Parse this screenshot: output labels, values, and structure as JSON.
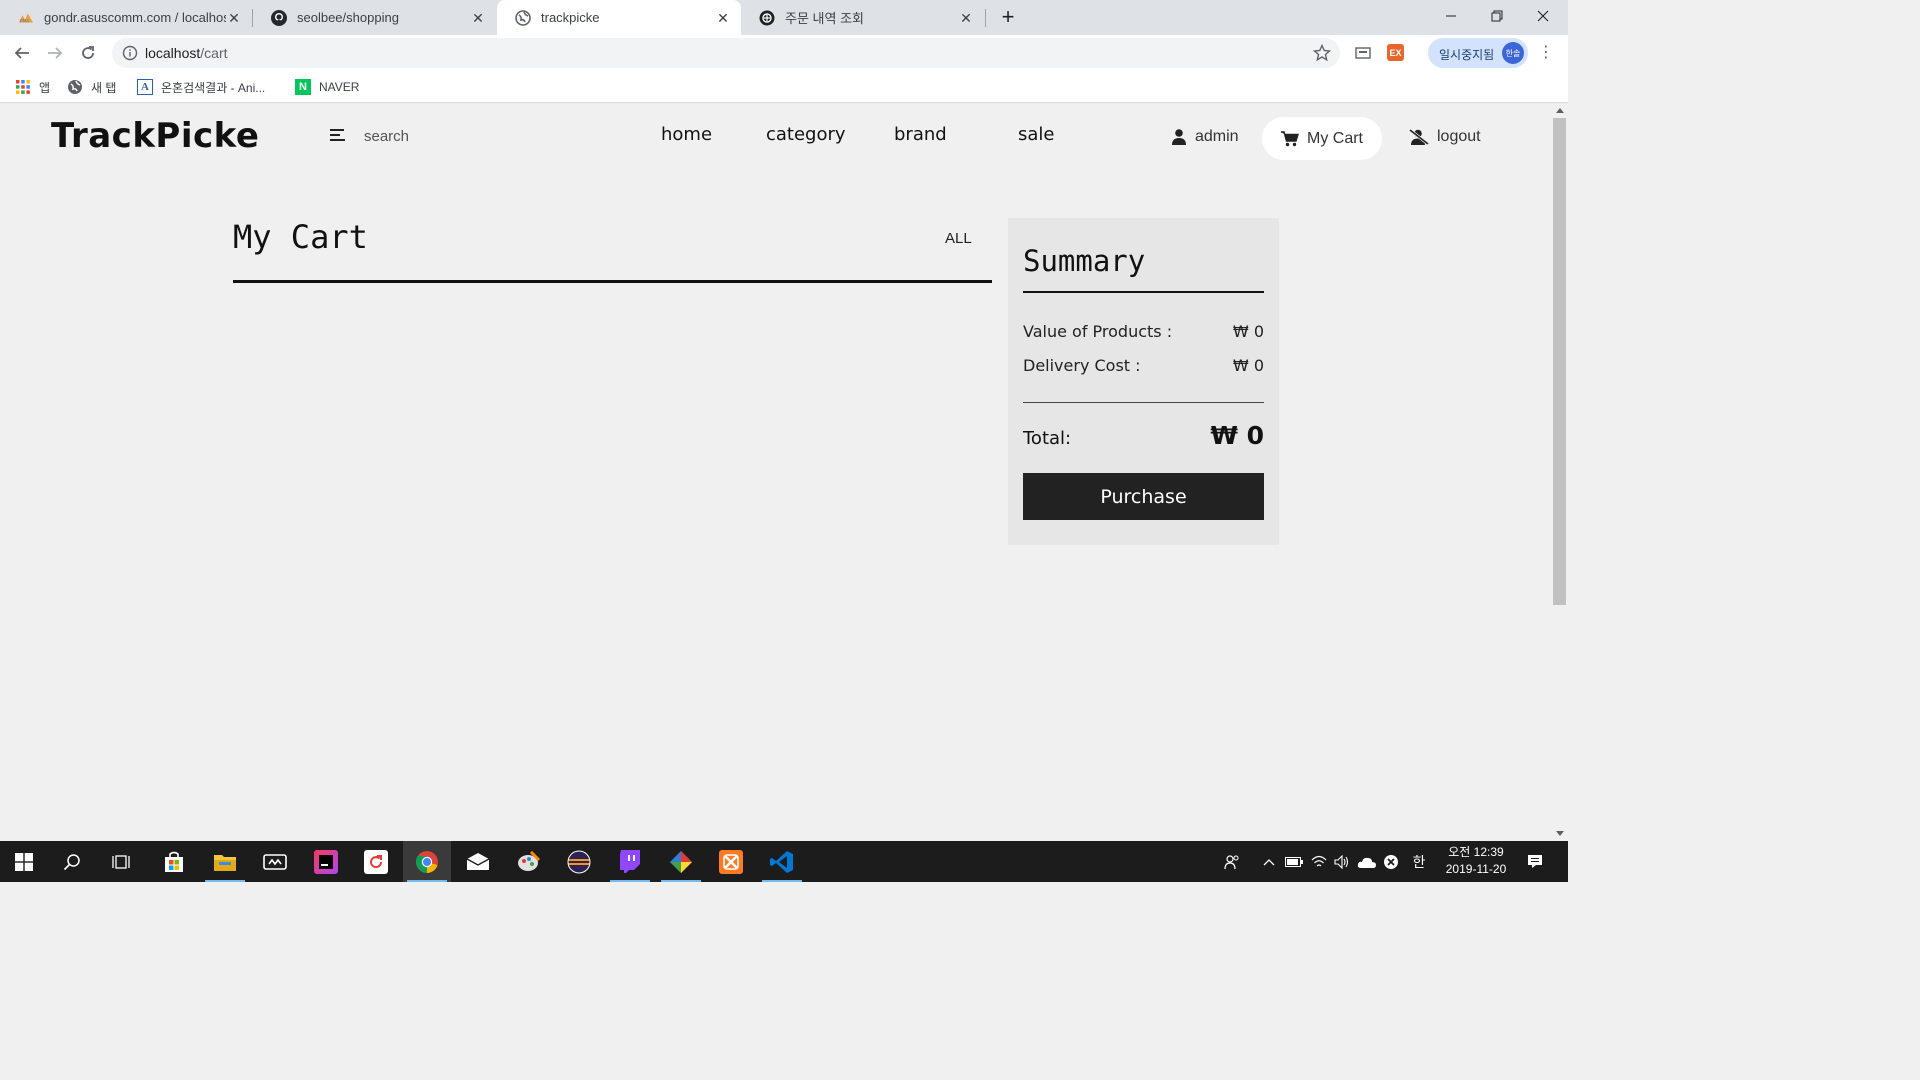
{
  "browser": {
    "tabs": [
      {
        "title": "gondr.asuscomm.com / localhost",
        "icon": "phpmyadmin-icon"
      },
      {
        "title": "seolbee/shopping",
        "icon": "github-icon"
      },
      {
        "title": "trackpicke",
        "icon": "globe-icon"
      },
      {
        "title": "주문 내역 조회",
        "icon": "site-icon"
      }
    ],
    "new_tab_symbol": "+",
    "url_host": "localhost",
    "url_path": "/cart",
    "profile_status": "일시중지됨",
    "profile_avatar": "한솔",
    "extension_label": "EX",
    "bookmarks": [
      {
        "label": "앱",
        "icon": "apps-grid-icon"
      },
      {
        "label": "새 탭",
        "icon": "globe-icon"
      },
      {
        "label": "온혼검색결과 - Ani...",
        "icon": "letter-a-icon",
        "badge": "A"
      },
      {
        "label": "NAVER",
        "icon": "naver-icon",
        "badge": "N"
      }
    ]
  },
  "site": {
    "logo": "TrackPicke",
    "search_label": "search",
    "nav": [
      "home",
      "category",
      "brand",
      "sale"
    ],
    "user_label": "admin",
    "cart_label": "My Cart",
    "logout_label": "logout"
  },
  "cart": {
    "title": "My Cart",
    "filter_label": "ALL"
  },
  "summary": {
    "heading": "Summary",
    "value_label": "Value of Products :",
    "value_amount": "₩ 0",
    "delivery_label": "Delivery Cost :",
    "delivery_amount": "₩ 0",
    "total_label": "Total:",
    "total_amount": "₩ 0",
    "purchase_label": "Purchase"
  },
  "taskbar": {
    "ime_label": "한",
    "clock_time": "오전 12:39",
    "clock_date": "2019-11-20"
  },
  "colors": {
    "accent_dark": "#222222",
    "page_bg": "#f0f0f0",
    "summary_bg": "#e6e6e6",
    "taskbar_bg": "#1c1c1c"
  }
}
